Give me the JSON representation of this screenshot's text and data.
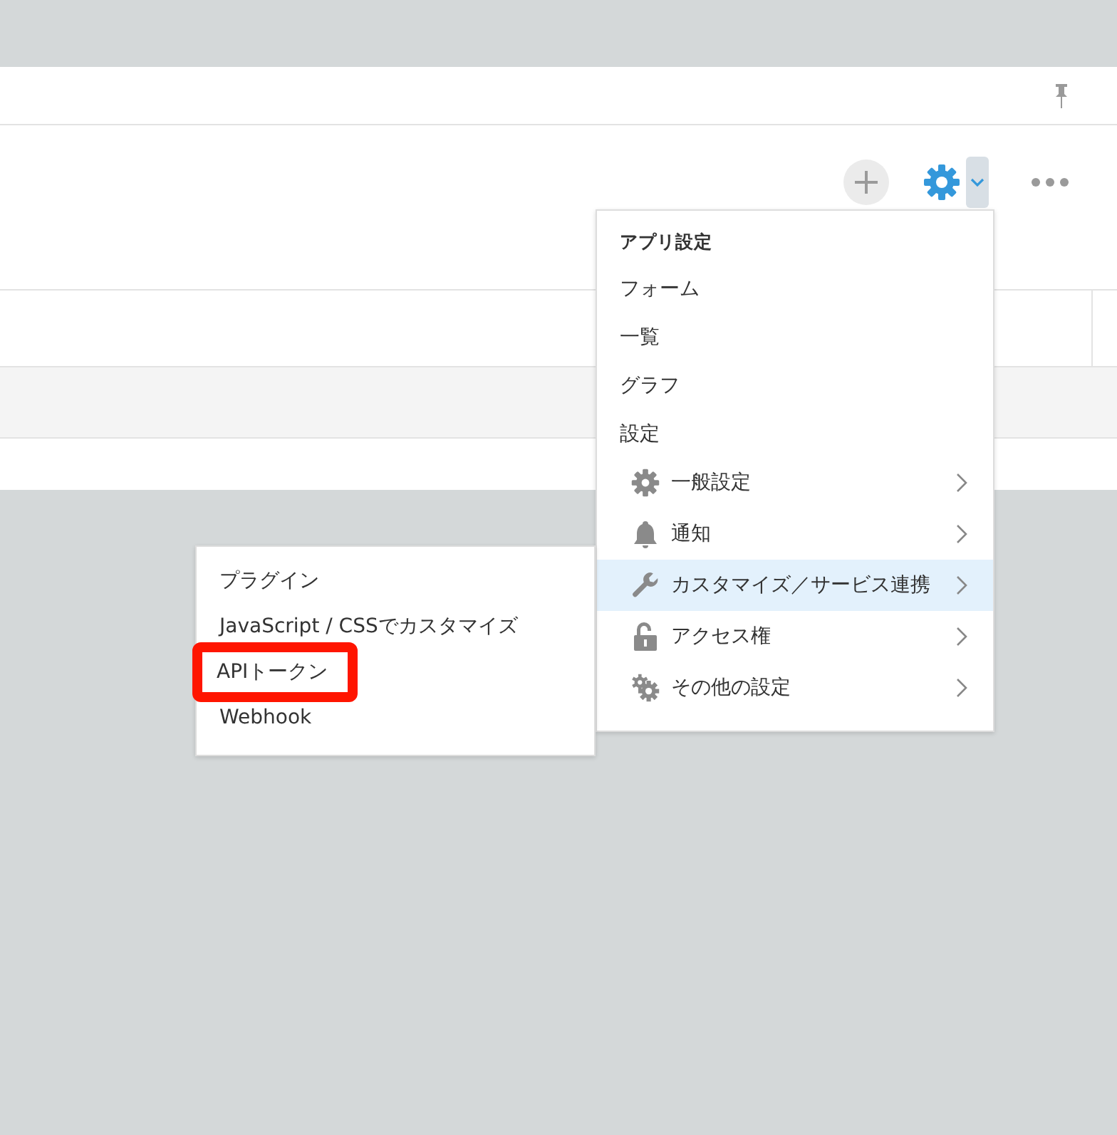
{
  "settings_menu": {
    "title": "アプリ設定",
    "links": [
      "フォーム",
      "一覧",
      "グラフ"
    ],
    "section_label": "設定",
    "items": [
      {
        "label": "一般設定",
        "selected": false
      },
      {
        "label": "通知",
        "selected": false
      },
      {
        "label": "カスタマイズ／サービス連携",
        "selected": true
      },
      {
        "label": "アクセス権",
        "selected": false
      },
      {
        "label": "その他の設定",
        "selected": false
      }
    ]
  },
  "submenu": {
    "items": [
      {
        "label": "プラグイン",
        "annotated": false
      },
      {
        "label": "JavaScript / CSSでカスタマイズ",
        "annotated": false
      },
      {
        "label": "APIトークン",
        "annotated": true
      },
      {
        "label": "Webhook",
        "annotated": false
      }
    ]
  }
}
